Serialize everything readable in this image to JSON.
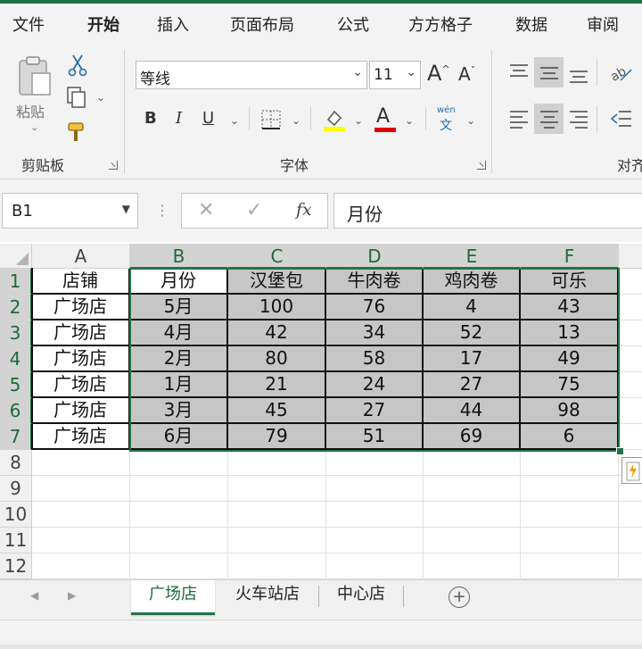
{
  "menu": {
    "tabs": [
      "文件",
      "开始",
      "插入",
      "页面布局",
      "公式",
      "方方格子",
      "数据",
      "审阅"
    ],
    "active": "开始"
  },
  "ribbon": {
    "clipboard": {
      "paste_label": "粘贴",
      "group_label": "剪贴板"
    },
    "font": {
      "font_name": "等线",
      "font_size": "11",
      "group_label": "字体",
      "bold": "B",
      "italic": "I",
      "underline": "U",
      "grow": "A",
      "shrink": "A",
      "font_color_letter": "A",
      "phonetic_top": "wén",
      "phonetic_bottom": "文"
    },
    "alignment": {
      "group_label": "对齐"
    },
    "colors": {
      "highlight": "#ffff00",
      "font_color": "#e00000"
    }
  },
  "formula_bar": {
    "name_box": "B1",
    "fx": "fx",
    "content": "月份"
  },
  "sheet": {
    "columns": [
      "A",
      "B",
      "C",
      "D",
      "E",
      "F"
    ],
    "rows": [
      "1",
      "2",
      "3",
      "4",
      "5",
      "6",
      "7",
      "8",
      "9",
      "10",
      "11",
      "12"
    ],
    "selected_range": "B1:F7",
    "data": [
      [
        "店铺",
        "月份",
        "汉堡包",
        "牛肉卷",
        "鸡肉卷",
        "可乐"
      ],
      [
        "广场店",
        "5月",
        "100",
        "76",
        "4",
        "43"
      ],
      [
        "广场店",
        "4月",
        "42",
        "34",
        "52",
        "13"
      ],
      [
        "广场店",
        "2月",
        "80",
        "58",
        "17",
        "49"
      ],
      [
        "广场店",
        "1月",
        "21",
        "24",
        "27",
        "75"
      ],
      [
        "广场店",
        "3月",
        "45",
        "27",
        "44",
        "98"
      ],
      [
        "广场店",
        "6月",
        "79",
        "51",
        "69",
        "6"
      ]
    ]
  },
  "sheet_tabs": {
    "tabs": [
      "广场店",
      "火车站店",
      "中心店"
    ],
    "active": "广场店",
    "add_label": "+"
  },
  "accent_color": "#217346"
}
